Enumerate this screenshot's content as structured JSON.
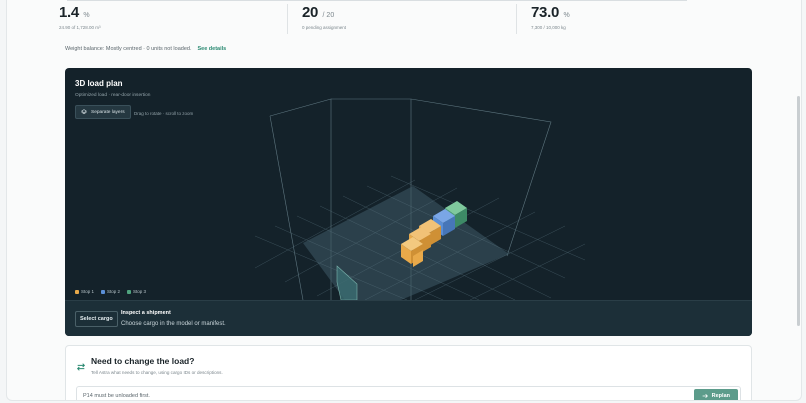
{
  "kpis": [
    {
      "value": "1.4",
      "unit": "%",
      "sub": "24.90 of 1,728.00 m³"
    },
    {
      "value": "20",
      "unit": "/ 20",
      "sub": "0 pending assignment"
    },
    {
      "value": "73.0",
      "unit": "%",
      "sub": "7,300 / 10,000 kg"
    }
  ],
  "balance": {
    "text": "Weight balance: Mostly centred · 0 units not loaded.",
    "link": "See details"
  },
  "plan": {
    "title": "3D load plan",
    "subtitle": "Optimized load · rear-door insertion",
    "separate_label": "Separate layers",
    "hint": "Drag to rotate · scroll to zoom",
    "legend": [
      {
        "label": "Stop 1",
        "color": "#e8a94a"
      },
      {
        "label": "Stop 2",
        "color": "#5b8fd6"
      },
      {
        "label": "Stop 3",
        "color": "#4fa37e"
      }
    ]
  },
  "inspect": {
    "button": "Select cargo",
    "title": "Inspect a shipment",
    "text": "Choose cargo in the model or manifest."
  },
  "change": {
    "title": "Need to change the load?",
    "subtitle": "Tell Astra what needs to change, using cargo IDs or descriptions.",
    "input_value": "P14 must be unloaded first.",
    "button": "Replan"
  },
  "icons": {
    "layers": "layers-icon",
    "change": "swap-arrows-icon",
    "arrow": "arrow-right-icon"
  }
}
